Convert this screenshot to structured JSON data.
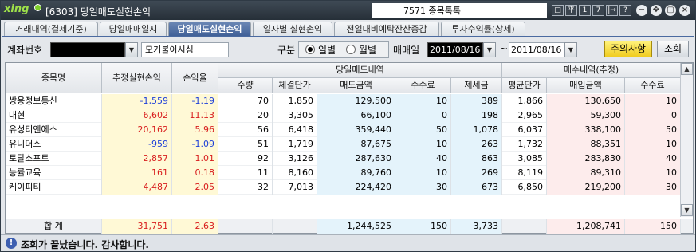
{
  "window": {
    "logo": "xing",
    "title": "[6303] 당일매도실현손익",
    "ticker": "7571 종목톡톡",
    "buttons": [
      "□",
      "平",
      "1",
      "7",
      "|→",
      "?"
    ]
  },
  "tabs": [
    "거래내역(결제기준)",
    "당일매매일지",
    "당일매도실현손익",
    "일자별 실현손익",
    "전일대비예탁잔산증감",
    "투자수익률(상세)"
  ],
  "active_tab": 2,
  "filters": {
    "account_label": "계좌번호",
    "account_name": "모거불이시심",
    "division_label": "구분",
    "daily_label": "일별",
    "monthly_label": "월별",
    "trade_date_label": "매매일",
    "date_from": "2011/08/16",
    "date_sep": "~",
    "date_to": "2011/08/16",
    "notice_button": "주의사항",
    "query_button": "조회"
  },
  "headers": {
    "name": "종목명",
    "est_pnl": "추정실현손익",
    "return_rate": "손익율",
    "sell_group": "당일매도내역",
    "buy_group": "매수내역(추정)",
    "qty": "수량",
    "price": "체결단가",
    "sell_amount": "매도금액",
    "fee": "수수료",
    "tax": "제세금",
    "avg_price": "평균단가",
    "buy_amount": "매입금액",
    "buy_fee": "수수료"
  },
  "rows": [
    {
      "name": "쌍용정보통신",
      "est_pnl": "-1,559",
      "return_rate": "-1.19",
      "qty": "70",
      "price": "1,850",
      "sell_amount": "129,500",
      "fee": "10",
      "tax": "389",
      "avg_price": "1,866",
      "buy_amount": "130,650",
      "buy_fee": "10"
    },
    {
      "name": "대현",
      "est_pnl": "6,602",
      "return_rate": "11.13",
      "qty": "20",
      "price": "3,305",
      "sell_amount": "66,100",
      "fee": "0",
      "tax": "198",
      "avg_price": "2,965",
      "buy_amount": "59,300",
      "buy_fee": "0"
    },
    {
      "name": "유성티엔에스",
      "est_pnl": "20,162",
      "return_rate": "5.96",
      "qty": "56",
      "price": "6,418",
      "sell_amount": "359,440",
      "fee": "50",
      "tax": "1,078",
      "avg_price": "6,037",
      "buy_amount": "338,100",
      "buy_fee": "50"
    },
    {
      "name": "유니더스",
      "est_pnl": "-959",
      "return_rate": "-1.09",
      "qty": "51",
      "price": "1,719",
      "sell_amount": "87,675",
      "fee": "10",
      "tax": "263",
      "avg_price": "1,732",
      "buy_amount": "88,351",
      "buy_fee": "10"
    },
    {
      "name": "토탈소프트",
      "est_pnl": "2,857",
      "return_rate": "1.01",
      "qty": "92",
      "price": "3,126",
      "sell_amount": "287,630",
      "fee": "40",
      "tax": "863",
      "avg_price": "3,085",
      "buy_amount": "283,830",
      "buy_fee": "40"
    },
    {
      "name": "능률교육",
      "est_pnl": "161",
      "return_rate": "0.18",
      "qty": "11",
      "price": "8,160",
      "sell_amount": "89,760",
      "fee": "10",
      "tax": "269",
      "avg_price": "8,119",
      "buy_amount": "89,310",
      "buy_fee": "10"
    },
    {
      "name": "케이피티",
      "est_pnl": "4,487",
      "return_rate": "2.05",
      "qty": "32",
      "price": "7,013",
      "sell_amount": "224,420",
      "fee": "30",
      "tax": "673",
      "avg_price": "6,850",
      "buy_amount": "219,200",
      "buy_fee": "30"
    }
  ],
  "total": {
    "label": "합  계",
    "est_pnl": "31,751",
    "return_rate": "2.63",
    "sell_amount": "1,244,525",
    "fee": "150",
    "tax": "3,733",
    "buy_amount": "1,208,741",
    "buy_fee": "150"
  },
  "status": {
    "message": "조회가 끝났습니다. 감사합니다."
  },
  "colors": {
    "negative": "#1d3fd8",
    "positive": "#d81d1d",
    "active_tab": "#3e5f96"
  }
}
